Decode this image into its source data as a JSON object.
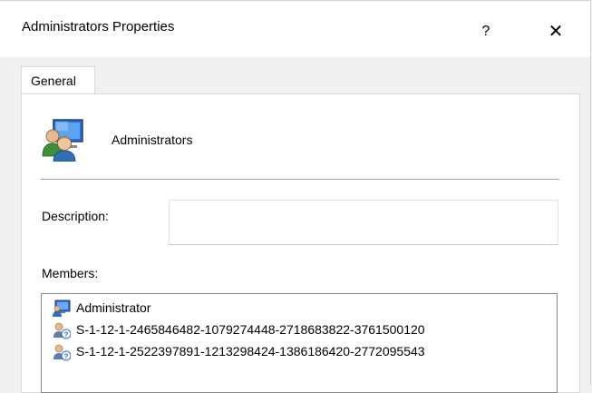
{
  "window": {
    "title": "Administrators Properties",
    "help_glyph": "?",
    "close_glyph": "✕"
  },
  "tabs": [
    {
      "label": "General",
      "selected": true
    }
  ],
  "general": {
    "group_name": "Administrators",
    "description_label": "Description:",
    "description_value": "",
    "members_label": "Members:",
    "members": [
      {
        "name": "Administrator",
        "icon": "user-icon"
      },
      {
        "name": "S-1-12-1-2465846482-1079274448-2718683822-3761500120",
        "icon": "unknown-user-icon"
      },
      {
        "name": "S-1-12-1-2522397891-1213298424-1386186420-2772095543",
        "icon": "unknown-user-icon"
      }
    ]
  },
  "colors": {
    "panel_bg": "#ffffff",
    "window_bg": "#f0f0f0",
    "border": "#d9d9d9",
    "separator": "#a0a0a0"
  }
}
